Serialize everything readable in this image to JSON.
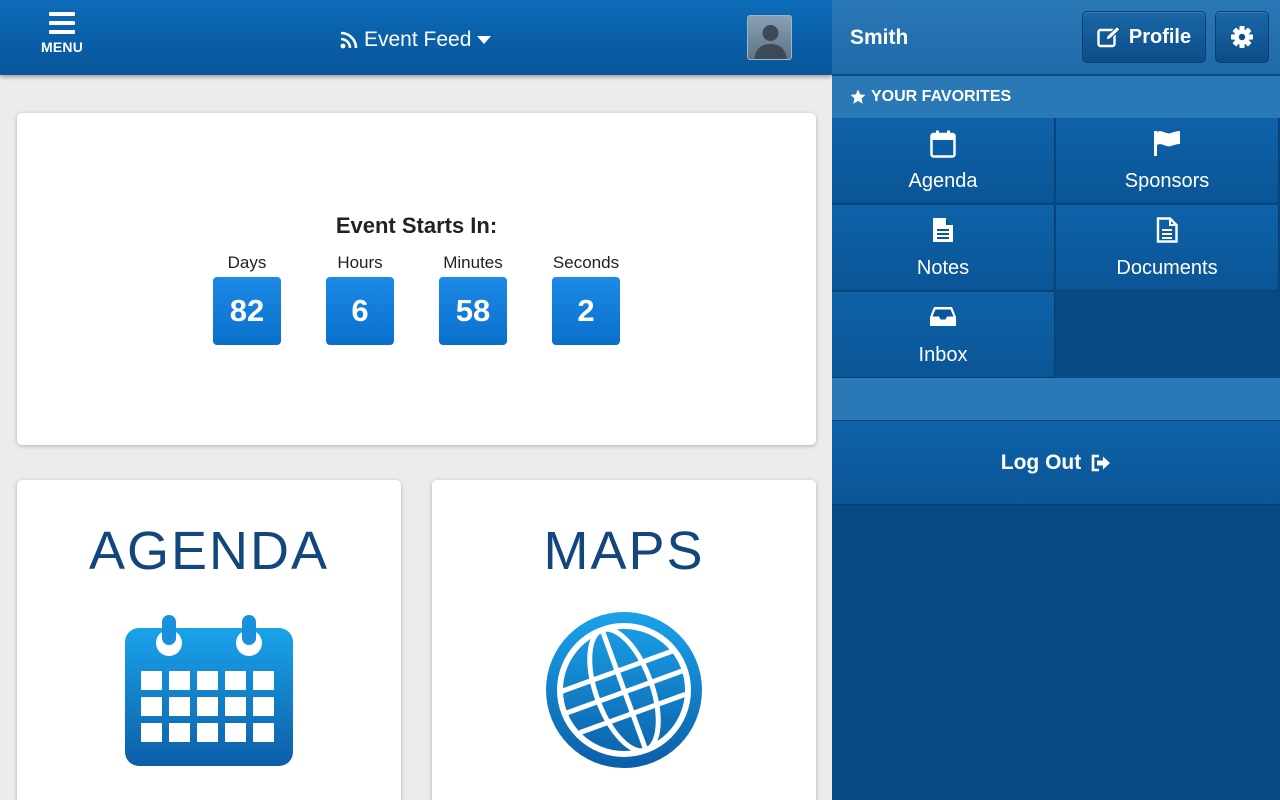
{
  "topbar": {
    "menu_label": "MENU",
    "feed_title": "Event Feed",
    "menu_icon": "hamburger-icon",
    "feed_icon": "rss-icon",
    "caret_icon": "caret-down-icon",
    "avatar_icon": "user-avatar-icon"
  },
  "countdown": {
    "title": "Event Starts In:",
    "units": [
      {
        "label": "Days",
        "value": "82"
      },
      {
        "label": "Hours",
        "value": "6"
      },
      {
        "label": "Minutes",
        "value": "58"
      },
      {
        "label": "Seconds",
        "value": "2"
      }
    ]
  },
  "tiles": [
    {
      "label": "AGENDA",
      "icon": "calendar-icon"
    },
    {
      "label": "MAPS",
      "icon": "globe-icon"
    }
  ],
  "side": {
    "user_name": "Smith",
    "profile_label": "Profile",
    "profile_icon": "edit-icon",
    "settings_icon": "gear-icon",
    "favorites_title": "YOUR FAVORITES",
    "favorites_icon": "star-icon",
    "favorites": [
      {
        "label": "Agenda",
        "icon": "calendar-icon"
      },
      {
        "label": "Sponsors",
        "icon": "flag-icon"
      },
      {
        "label": "Notes",
        "icon": "file-icon"
      },
      {
        "label": "Documents",
        "icon": "document-icon"
      },
      {
        "label": "Inbox",
        "icon": "inbox-icon"
      }
    ],
    "logout_label": "Log Out",
    "logout_icon": "sign-out-icon"
  },
  "colors": {
    "topbar": "#0a60a8",
    "side_panel": "#054a82",
    "countdown_box": "#1380da",
    "tile_text": "#12467c"
  }
}
